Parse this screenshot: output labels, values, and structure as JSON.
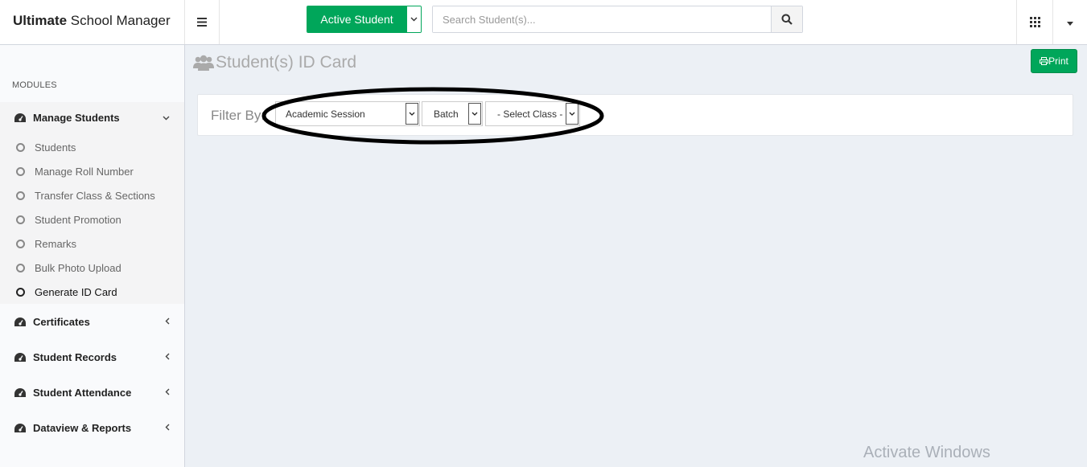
{
  "brand": {
    "bold": "Ultimate",
    "rest": " School Manager"
  },
  "header": {
    "active_student_label": "Active Student",
    "search_placeholder": "Search Student(s)..."
  },
  "sidebar": {
    "modules_header": "MODULES",
    "manage_students": "Manage Students",
    "sub_items": [
      "Students",
      "Manage Roll Number",
      "Transfer Class & Sections",
      "Student Promotion",
      "Remarks",
      "Bulk Photo Upload",
      "Generate ID Card"
    ],
    "other_items": [
      "Certificates",
      "Student Records",
      "Student Attendance",
      "Dataview & Reports"
    ]
  },
  "main": {
    "title": "Student(s) ID Card",
    "print_label": "Print",
    "filter_label": "Filter By:",
    "filters": {
      "session": "Academic Session",
      "batch": "Batch",
      "class": "- Select Class -"
    }
  },
  "watermark": "Activate Windows",
  "colors": {
    "accent_green": "#00a65a",
    "background": "#ecf0f5"
  }
}
